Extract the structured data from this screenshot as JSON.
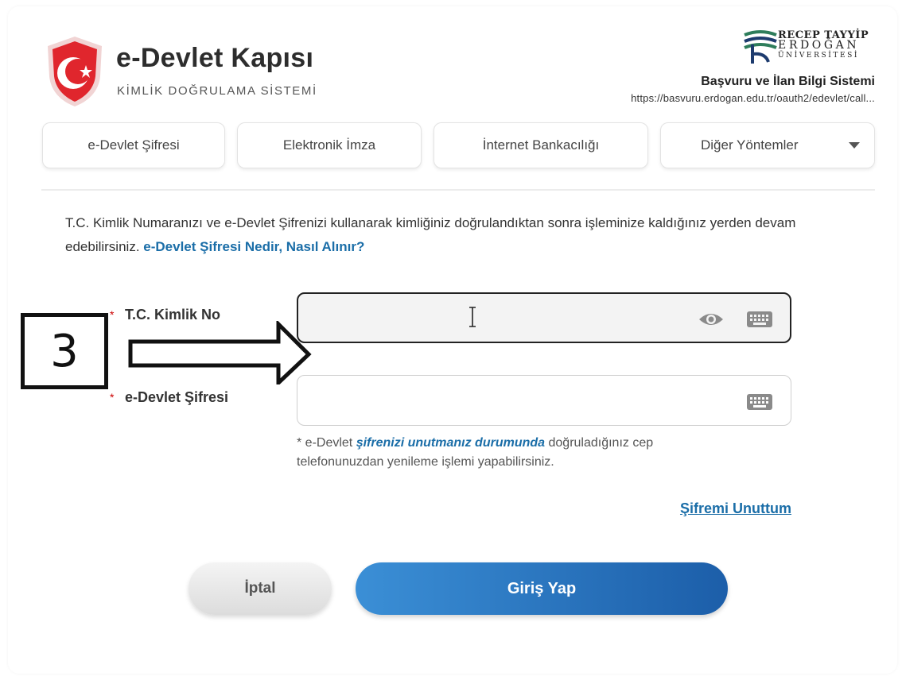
{
  "header": {
    "brand_title": "e-Devlet Kapısı",
    "brand_subtitle": "KİMLİK DOĞRULAMA SİSTEMİ",
    "uni_line1": "RECEP TAYYİP",
    "uni_line2": "ERDOĞAN",
    "uni_line3": "ÜNİVERSİTESİ",
    "app_name": "Başvuru ve İlan Bilgi Sistemi",
    "app_url": "https://basvuru.erdogan.edu.tr/oauth2/edevlet/call..."
  },
  "tabs": [
    {
      "label": "e-Devlet Şifresi"
    },
    {
      "label": "Elektronik İmza"
    },
    {
      "label": "İnternet Bankacılığı"
    },
    {
      "label": "Diğer Yöntemler"
    }
  ],
  "intro": {
    "text": "T.C. Kimlik Numaranızı ve e-Devlet Şifrenizi kullanarak kimliğiniz doğrulandıktan sonra işleminize kaldığınız yerden devam edebilirsiniz.",
    "link": "e-Devlet Şifresi Nedir, Nasıl Alınır?"
  },
  "form": {
    "required_mark": "*",
    "tc_label": "T.C. Kimlik No",
    "tc_value": "",
    "password_label": "e-Devlet Şifresi",
    "password_value": "",
    "note_prefix": "* e-Devlet ",
    "note_emphasis": "şifrenizi unutmanız durumunda",
    "note_suffix": " doğruladığınız cep telefonunuzdan yenileme işlemi yapabilirsiniz.",
    "forgot_link": "Şifremi Unuttum"
  },
  "buttons": {
    "cancel": "İptal",
    "login": "Giriş Yap"
  },
  "annotation": {
    "step_number": "3"
  },
  "colors": {
    "brand_red": "#e0262d",
    "link_blue": "#1b6ea8",
    "login_blue": "#1c5ea9",
    "uni_green": "#2e7d5b",
    "uni_navy": "#1d3b6e"
  }
}
